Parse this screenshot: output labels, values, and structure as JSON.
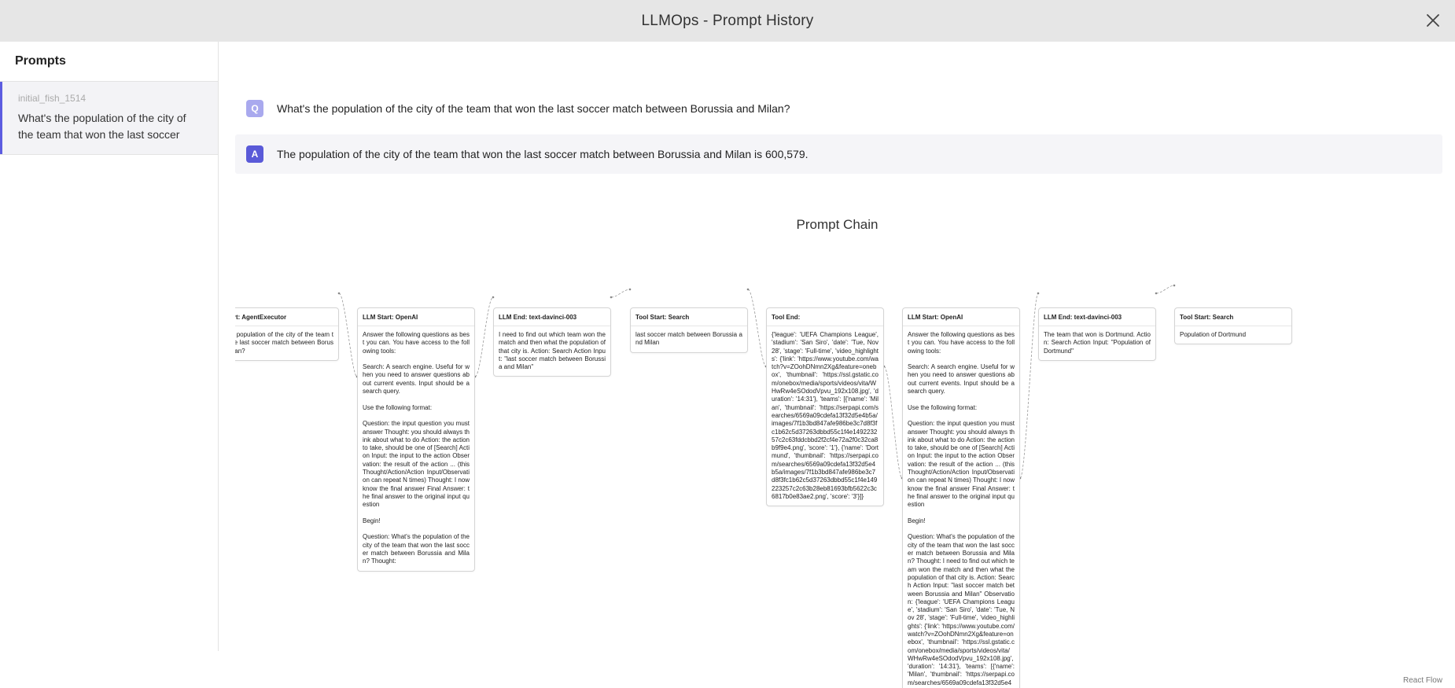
{
  "header": {
    "title": "LLMOps - Prompt History"
  },
  "sidebar": {
    "title": "Prompts",
    "items": [
      {
        "id": "initial_fish_1514",
        "text": "What's the population of the city of the team that won the last soccer"
      }
    ]
  },
  "question": {
    "badge": "Q",
    "text": "What's the population of the city of the team that won the last soccer match between Borussia and Milan?"
  },
  "answer": {
    "badge": "A",
    "text": "The population of the city of the team that won the last soccer match between Borussia and Milan is 600,579."
  },
  "chain": {
    "title": "Prompt Chain",
    "nodes": [
      {
        "title": "Chain Start: AgentExecutor",
        "body": "What's the population of the city of the team that won the last soccer match between Borussia and Milan?"
      },
      {
        "title": "LLM Start: OpenAI",
        "body": "Answer the following questions as best you can. You have access to the following tools:\n\nSearch: A search engine. Useful for when you need to answer questions about current events. Input should be a search query.\n\nUse the following format:\n\nQuestion: the input question you must answer Thought: you should always think about what to do Action: the action to take, should be one of [Search] Action Input: the input to the action Observation: the result of the action ... (this Thought/Action/Action Input/Observation can repeat N times) Thought: I now know the final answer Final Answer: the final answer to the original input question\n\nBegin!\n\nQuestion: What's the population of the city of the team that won the last soccer match between Borussia and Milan? Thought:"
      },
      {
        "title": "LLM End: text-davinci-003",
        "body": "I need to find out which team won the match and then what the population of that city is. Action: Search Action Input: \"last soccer match between Borussia and Milan\""
      },
      {
        "title": "Tool Start: Search",
        "body": "last soccer match between Borussia and Milan"
      },
      {
        "title": "Tool End:",
        "body": "{'league': 'UEFA Champions League', 'stadium': 'San Siro', 'date': 'Tue, Nov 28', 'stage': 'Full-time', 'video_highlights': {'link': 'https://www.youtube.com/watch?v=ZOohDNmn2Xg&feature=onebox', 'thumbnail': 'https://ssl.gstatic.com/onebox/media/sports/videos/vita/WHwRw4eSOdodVpvu_192x108.jpg', 'duration': '14:31'}, 'teams': [{'name': 'Milan', 'thumbnail': 'https://serpapi.com/searches/6569a09cdefa13f32d5e4b5a/images/7f1b3bd847afe986be3c7d8f3fc1b62c5d37263dbbd55c1f4e149223257c2c63fddcbbd2f2cf4e72a2f0c32ca8b9f9e4.png', 'score': '1'}, {'name': 'Dortmund', 'thumbnail': 'https://serpapi.com/searches/6569a09cdefa13f32d5e4b5a/images/7f1b3bd847afe986be3c7d8f3fc1b62c5d37263dbbd55c1f4e149223257c2c63b28eb81693bfb5622c3c6817b0e83ae2.png', 'score': '3'}]}"
      },
      {
        "title": "LLM Start: OpenAI",
        "body": "Answer the following questions as best you can. You have access to the following tools:\n\nSearch: A search engine. Useful for when you need to answer questions about current events. Input should be a search query.\n\nUse the following format:\n\nQuestion: the input question you must answer Thought: you should always think about what to do Action: the action to take, should be one of [Search] Action Input: the input to the action Observation: the result of the action ... (this Thought/Action/Action Input/Observation can repeat N times) Thought: I now know the final answer Final Answer: the final answer to the original input question\n\nBegin!\n\nQuestion: What's the population of the city of the team that won the last soccer match between Borussia and Milan? Thought: I need to find out which team won the match and then what the population of that city is. Action: Search Action Input: \"last soccer match between Borussia and Milan\" Observation: {'league': 'UEFA Champions League', 'stadium': 'San Siro', 'date': 'Tue, Nov 28', 'stage': 'Full-time', 'video_highlights': {'link': 'https://www.youtube.com/watch?v=ZOohDNmn2Xg&feature=onebox', 'thumbnail': 'https://ssl.gstatic.com/onebox/media/sports/videos/vita/WHwRw4eSOdodVpvu_192x108.jpg', 'duration': '14:31'}, 'teams': [{'name': 'Milan', 'thumbnail': 'https://serpapi.com/searches/6569a09cdefa13f32d5e4b5a/images/7f1b3bd847afe986be3c7d8f3fc1b62c5d37263dbbd55c1f4e14"
      },
      {
        "title": "LLM End: text-davinci-003",
        "body": "The team that won is Dortmund. Action: Search Action Input: \"Population of Dortmund\""
      },
      {
        "title": "Tool Start: Search",
        "body": "Population of Dortmund"
      }
    ]
  },
  "footer": {
    "attribution": "React Flow"
  },
  "colors": {
    "accent": "#5a5ad8",
    "accent_light": "#a9a9ee",
    "header_bg": "#e6e6e6"
  }
}
